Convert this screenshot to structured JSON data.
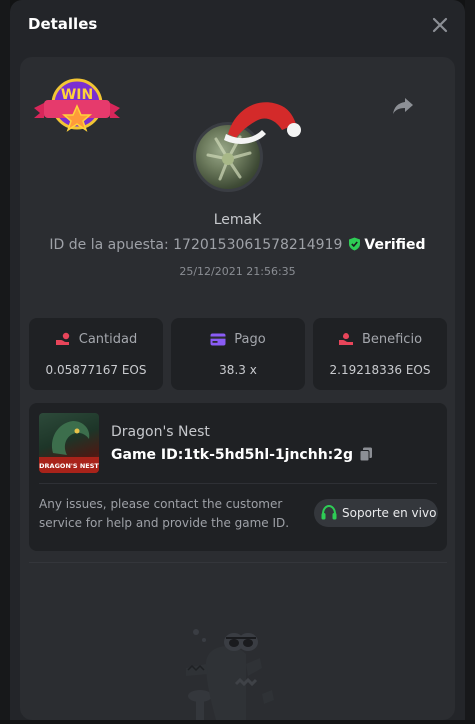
{
  "modal": {
    "title": "Detalles"
  },
  "player": {
    "username": "LemaK"
  },
  "bet": {
    "id_label": "ID de la apuesta:",
    "id_value": "1720153061578214919",
    "verified_label": "Verified",
    "date": "25/12/2021 21:56:35"
  },
  "badge": {
    "text": "WIN"
  },
  "stats": [
    {
      "label": "Cantidad",
      "value": "0.05877167 EOS",
      "icon": "coin-hand-icon",
      "color": "#e8455a"
    },
    {
      "label": "Pago",
      "value": "38.3 x",
      "icon": "card-icon",
      "color": "#8a5cf6"
    },
    {
      "label": "Beneficio",
      "value": "2.19218336 EOS",
      "icon": "profit-hand-icon",
      "color": "#e8455a"
    }
  ],
  "game": {
    "name": "Dragon's Nest",
    "thumb_caption": "DRAGON'S NEST",
    "id_label": "Game ID:",
    "id_value": "1tk-5hd5hl-1jnchh:2g"
  },
  "support": {
    "message": "Any issues, please contact the customer service for help and provide the game ID.",
    "button_label": "Soporte en vivo"
  },
  "colors": {
    "accent_green": "#2ecc55",
    "modal_bg": "#232529",
    "panel_bg": "#2b2d31"
  }
}
